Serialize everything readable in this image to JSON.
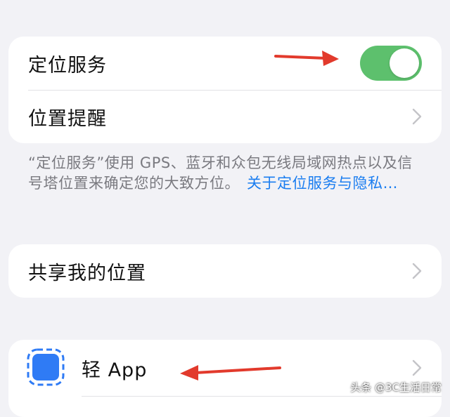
{
  "location_card": {
    "location_services_label": "定位服务",
    "location_services_enabled": true,
    "location_alerts_label": "位置提醒"
  },
  "footer": {
    "description": "“定位服务”使用 GPS、蓝牙和众包无线局域网热点以及信号塔位置来确定您的大致方位。",
    "link": "关于定位服务与隐私…"
  },
  "share_card": {
    "share_location_label": "共享我的位置"
  },
  "apps_card": {
    "app_name": "轻 App"
  },
  "icons": {
    "chevron": "chevron-right-icon",
    "app": "app-clip-icon",
    "annotation": "red-arrow-icon"
  },
  "colors": {
    "toggle_on": "#5dc06d",
    "link": "#1a7df0",
    "annotation_arrow": "#e23a2c",
    "app_icon": "#2f7bf5"
  },
  "watermark": "头条 @3C生活日常"
}
